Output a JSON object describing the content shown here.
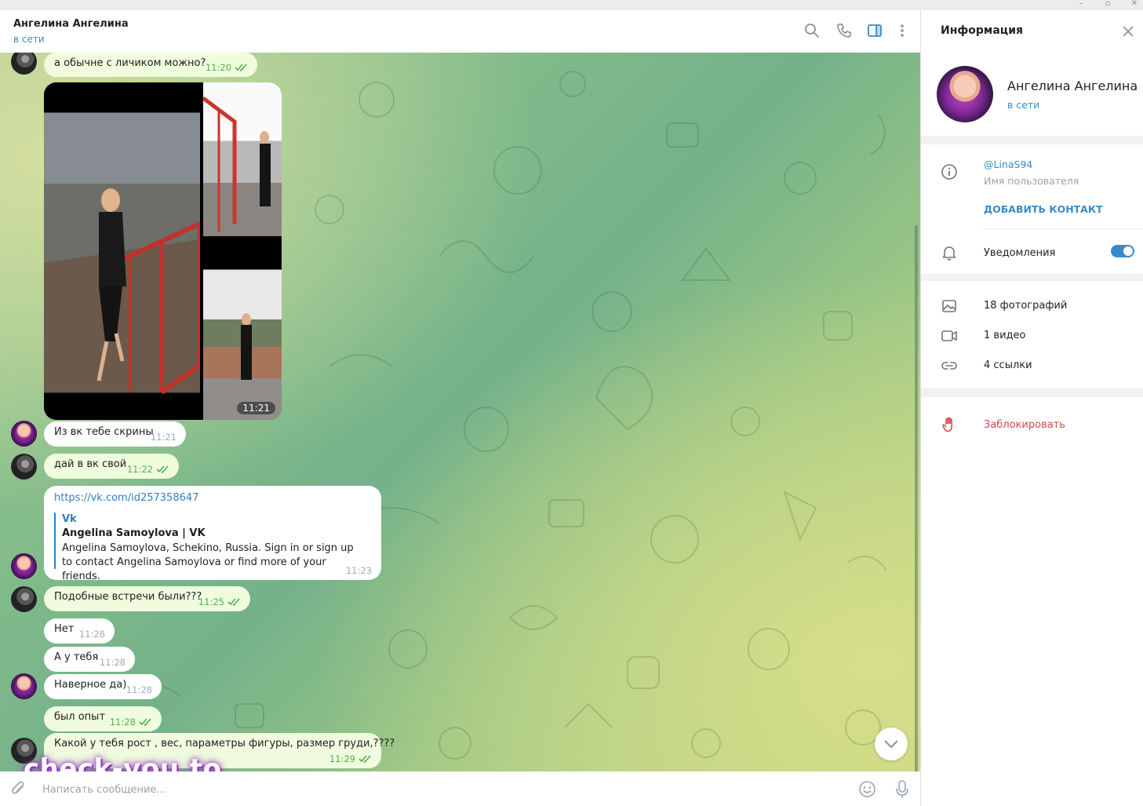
{
  "header": {
    "peer_name": "Ангелина Ангелина",
    "peer_status": "в сети",
    "icons": [
      "search-icon",
      "phone-icon",
      "sidebar-toggle-icon",
      "more-vertical-icon"
    ]
  },
  "messages": [
    {
      "from": "me",
      "text": "а обычне с личиком можно?",
      "time": "11:20",
      "read": true
    },
    {
      "from": "her",
      "type": "album",
      "photos": 3,
      "time": "11:21"
    },
    {
      "from": "her",
      "text": "Из вк тебе скрины",
      "time": "11:21"
    },
    {
      "from": "me",
      "text": "дай в вк свой",
      "time": "11:22",
      "read": true
    },
    {
      "from": "her",
      "type": "link",
      "url": "https://vk.com/id257358647",
      "site": "Vk",
      "title": "Angelina Samoylova | VK",
      "description": "Angelina Samoylova, Schekino, Russia. Sign in or sign up to contact Angelina Samoylova or find more of your friends.",
      "time": "11:23"
    },
    {
      "from": "me",
      "text": "Подобные встречи были???",
      "time": "11:25",
      "read": true
    },
    {
      "from": "her",
      "text": "Нет",
      "time": "11:28"
    },
    {
      "from": "her",
      "text": "А у тебя",
      "time": "11:28"
    },
    {
      "from": "her",
      "text": "Наверное да)",
      "time": "11:28"
    },
    {
      "from": "me",
      "text": "был опыт",
      "time": "11:28",
      "read": true
    },
    {
      "from": "me",
      "text": "Какой у тебя рост , вес, параметры фигуры, размер груди,????",
      "time": "11:29",
      "read": true
    }
  ],
  "watermark": "check-you.to",
  "input": {
    "placeholder": "Написать сообщение..."
  },
  "info_panel": {
    "title": "Информация",
    "name": "Ангелина Ангелина",
    "status": "в сети",
    "username": "@LinaS94",
    "username_label": "Имя пользователя",
    "add_contact": "ДОБАВИТЬ КОНТАКТ",
    "notifications": "Уведомления",
    "notifications_on": true,
    "photos": "18 фотографий",
    "videos": "1 видео",
    "links": "4 ссылки",
    "block": "Заблокировать"
  },
  "colors": {
    "accent": "#3a8ac9",
    "outgoing_bubble": "#effdde",
    "incoming_bubble": "#ffffff",
    "read_check": "#4fae4e",
    "danger": "#d24949",
    "watermark_glow": "#9b34c8"
  }
}
